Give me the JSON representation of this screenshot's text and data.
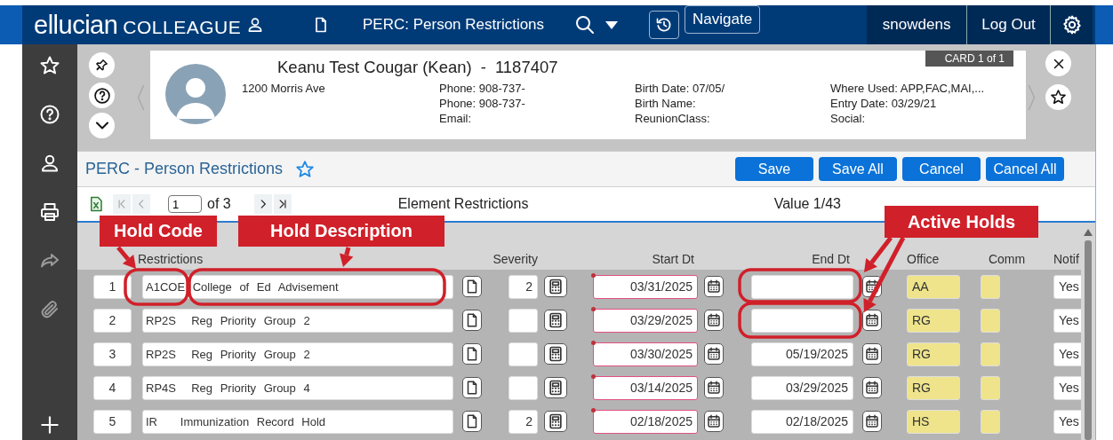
{
  "header": {
    "logo": "ellucian",
    "product": "COLLEAGUE",
    "form_title": "PERC: Person Restrictions",
    "nav_button": "Navigate",
    "user": "snowdens",
    "logout": "Log Out"
  },
  "person": {
    "name": "Keanu Test Cougar (Kean)",
    "separator": "-",
    "id": "1187407",
    "card_badge": "CARD 1 of 1",
    "address": "1200 Morris Ave",
    "columns": [
      {
        "lines": [
          "Phone: 908-737-",
          "Phone: 908-737-",
          "Email:"
        ]
      },
      {
        "lines": [
          "Birth Date: 07/05/",
          "Birth Name:",
          "ReunionClass:"
        ]
      },
      {
        "lines": [
          "Where Used: APP,FAC,MAI,...",
          "Entry Date: 03/29/21",
          "Social:"
        ]
      }
    ]
  },
  "form": {
    "title": "PERC - Person Restrictions",
    "buttons": [
      "Save",
      "Save All",
      "Cancel",
      "Cancel All"
    ]
  },
  "pager": {
    "page": "1",
    "total": "of 3",
    "buttons": [
      {
        "kind": "first",
        "disabled": true
      },
      {
        "kind": "prev",
        "disabled": true
      },
      {
        "kind": "next",
        "disabled": false
      },
      {
        "kind": "last",
        "disabled": false
      }
    ]
  },
  "section_title": "Element Restrictions",
  "value_count": "Value 1/43",
  "table": {
    "columns": [
      "Restrictions",
      "Severity",
      "Start Dt",
      "End Dt",
      "Office",
      "Comm",
      "Notif"
    ],
    "rows": [
      {
        "number": "1",
        "restriction": "A1COE College of Ed Advisement",
        "severity": "2",
        "start_dt": "03/31/2025",
        "start_required": true,
        "office": "AA",
        "notify": "Yes"
      },
      {
        "number": "2",
        "restriction": "RP2S  Reg Priority Group 2",
        "start_dt": "03/29/2025",
        "start_required": true,
        "office": "RG",
        "notify": "Yes"
      },
      {
        "number": "3",
        "restriction": "RP2S  Reg Priority Group 2",
        "start_dt": "03/30/2025",
        "start_required": true,
        "end_dt": "05/19/2025",
        "office": "RG",
        "notify": "Yes"
      },
      {
        "number": "4",
        "restriction": "RP4S  Reg Priority Group 4",
        "start_dt": "03/14/2025",
        "start_required": true,
        "end_dt": "03/29/2025",
        "office": "RG",
        "notify": "Yes"
      },
      {
        "number": "5",
        "restriction": "IR   Immunization Record Hold",
        "severity": "2",
        "start_dt": "02/18/2025",
        "start_required": true,
        "end_dt": "02/18/2025",
        "office": "HS",
        "notify": "Yes"
      }
    ]
  },
  "annotations": [
    {
      "text": "Hold Code"
    },
    {
      "text": "Hold Description"
    },
    {
      "text": "Active Holds"
    }
  ]
}
